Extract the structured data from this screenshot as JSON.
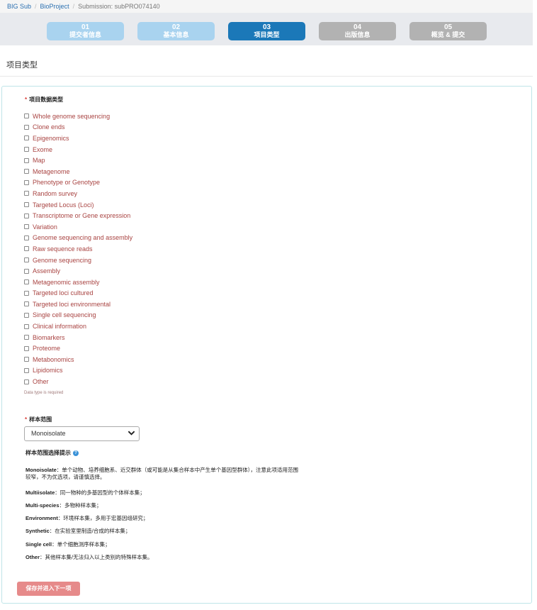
{
  "breadcrumb": {
    "items": [
      "BIG Sub",
      "BioProject"
    ],
    "current": "Submission: subPRO074140"
  },
  "steps": [
    {
      "num": "01",
      "label": "提交者信息",
      "state": "done"
    },
    {
      "num": "02",
      "label": "基本信息",
      "state": "done"
    },
    {
      "num": "03",
      "label": "项目类型",
      "state": "active"
    },
    {
      "num": "04",
      "label": "出版信息",
      "state": "todo"
    },
    {
      "num": "05",
      "label": "概览 & 提交",
      "state": "todo"
    }
  ],
  "page": {
    "heading": "项目类型"
  },
  "data_type": {
    "required_mark": "*",
    "title": "项目数据类型",
    "options": [
      "Whole genome sequencing",
      "Clone ends",
      "Epigenomics",
      "Exome",
      "Map",
      "Metagenome",
      "Phenotype or Genotype",
      "Random survey",
      "Targeted Locus (Loci)",
      "Transcriptome or Gene expression",
      "Variation",
      "Genome sequencing and assembly",
      "Raw sequence reads",
      "Genome sequencing",
      "Assembly",
      "Metagenomic assembly",
      "Targeted loci cultured",
      "Targeted loci environmental",
      "Single cell sequencing",
      "Clinical information",
      "Biomarkers",
      "Proteome",
      "Metabonomics",
      "Lipidomics",
      "Other"
    ],
    "hint": "Data type is required"
  },
  "sample_scope": {
    "required_mark": "*",
    "title": "样本范围",
    "selected": "Monoisolate",
    "tip_title": "样本范围选择提示",
    "tips": [
      {
        "term": "Monoisolate",
        "desc": "：单个动物、培养细胞系、近交群体（或可能是从集合样本中产生单个基因型群体），注意此项适用范围较窄，不为优选项，请谨慎选择。"
      },
      {
        "term": "Multiisolate",
        "desc": "：同一物种的多基因型的个体样本集；"
      },
      {
        "term": "Multi-species",
        "desc": "：多物种样本集；"
      },
      {
        "term": "Environment",
        "desc": "：环境样本集，多用于宏基因组研究；"
      },
      {
        "term": "Synthetic",
        "desc": "：在实验室里制造/合成的样本集；"
      },
      {
        "term": "Single cell",
        "desc": "：单个细胞测序样本集；"
      },
      {
        "term": "Other",
        "desc": "：其他样本集/无法归入以上类别的特殊样本集。"
      }
    ]
  },
  "actions": {
    "save_next": "保存并进入下一项"
  },
  "colors": {
    "active_step": "#1b78b8",
    "done_step": "#a9d3ef",
    "todo_step": "#b2b2b2",
    "option_text": "#a94442",
    "save_button": "#e68a8a"
  }
}
